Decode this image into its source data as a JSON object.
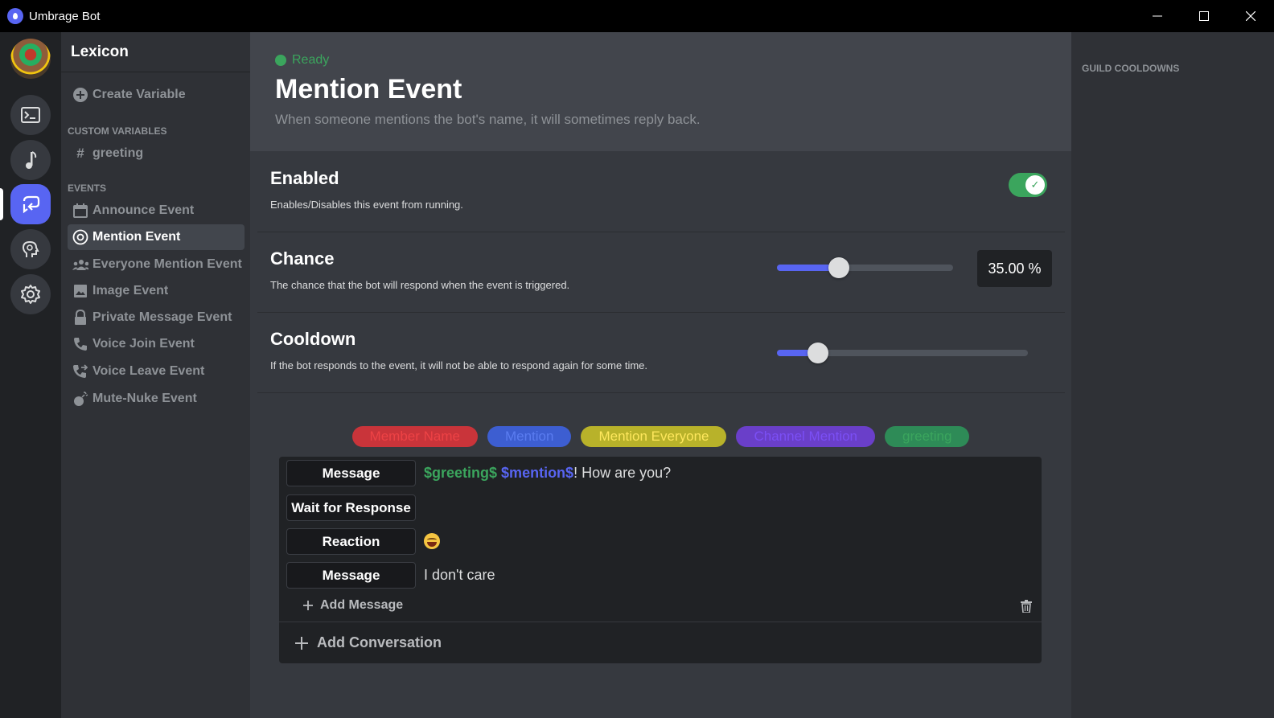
{
  "window": {
    "title": "Umbrage Bot",
    "minimize_glyph": "—",
    "maximize_glyph": "☐",
    "close_glyph": "✕"
  },
  "rail": {
    "buttons": [
      "terminal-icon",
      "music-icon",
      "loop-icon",
      "head-icon",
      "gear-icon"
    ],
    "active_index": 2
  },
  "sidebar": {
    "title": "Lexicon",
    "create_variable": "Create Variable",
    "custom_variables_header": "CUSTOM VARIABLES",
    "variables": [
      {
        "label": "greeting",
        "icon": "#"
      }
    ],
    "events_header": "EVENTS",
    "events": [
      {
        "label": "Announce Event",
        "icon": "calendar-icon"
      },
      {
        "label": "Mention Event",
        "icon": "at-icon",
        "active": true
      },
      {
        "label": "Everyone Mention Event",
        "icon": "people-icon"
      },
      {
        "label": "Image Event",
        "icon": "image-icon"
      },
      {
        "label": "Private Message Event",
        "icon": "lock-icon"
      },
      {
        "label": "Voice Join Event",
        "icon": "phone-icon"
      },
      {
        "label": "Voice Leave Event",
        "icon": "phone-forward-icon"
      },
      {
        "label": "Mute-Nuke Event",
        "icon": "bomb-icon"
      }
    ]
  },
  "main": {
    "status": "Ready",
    "title": "Mention Event",
    "description": "When someone mentions the bot's name, it will sometimes reply back.",
    "settings": {
      "enabled": {
        "label": "Enabled",
        "desc": "Enables/Disables this event from running.",
        "value": true
      },
      "chance": {
        "label": "Chance",
        "desc": "The chance that the bot will respond when the event is triggered.",
        "value_display": "35.00 %",
        "fraction": 0.35
      },
      "cooldown": {
        "label": "Cooldown",
        "desc": "If the bot responds to the event, it will not be able to respond again for some time.",
        "fraction": 0.165
      }
    },
    "chips": [
      {
        "label": "Member Name",
        "bg": "#c9343a",
        "fg": "#ed4245"
      },
      {
        "label": "Mention",
        "bg": "#3d5ed1",
        "fg": "#5a7cf0"
      },
      {
        "label": "Mention Everyone",
        "bg": "#b8b22a",
        "fg": "#fee75c"
      },
      {
        "label": "Channel Mention",
        "bg": "#6a3fc9",
        "fg": "#7b4ff5"
      },
      {
        "label": "greeting",
        "bg": "#2e8b57",
        "fg": "#3ba55d"
      }
    ],
    "conversation": {
      "messages": [
        {
          "type": "Message",
          "tok1": "$greeting$",
          "tok2": "$mention$",
          "rest": "! How are you?"
        },
        {
          "type": "Wait for Response"
        },
        {
          "type": "Reaction",
          "emoji": "grinning-squint-emoji"
        },
        {
          "type": "Message",
          "text": "I don't care"
        }
      ],
      "add_message": "Add Message",
      "add_conversation": "Add Conversation"
    }
  },
  "right_panel": {
    "title": "GUILD COOLDOWNS"
  }
}
